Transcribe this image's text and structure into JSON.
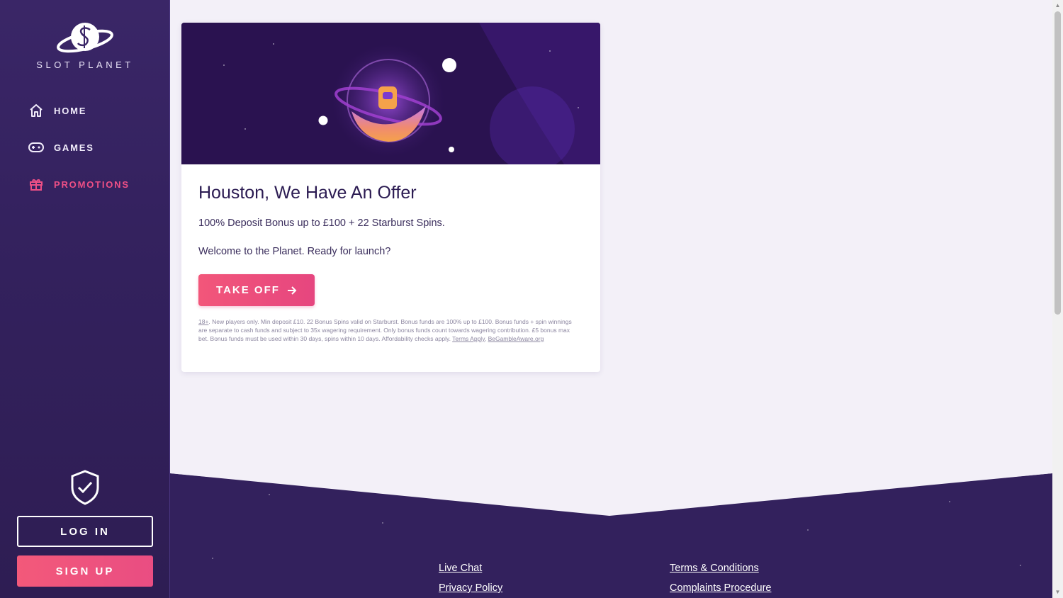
{
  "brand": {
    "name": "SLOT PLANET"
  },
  "nav": [
    {
      "label": "HOME",
      "icon": "home-icon",
      "active": false
    },
    {
      "label": "GAMES",
      "icon": "gamepad-icon",
      "active": false
    },
    {
      "label": "PROMOTIONS",
      "icon": "gift-icon",
      "active": true
    }
  ],
  "auth": {
    "login_label": "LOG IN",
    "signup_label": "SIGN UP"
  },
  "promo": {
    "title": "Houston, We Have An Offer",
    "line1": "100% Deposit Bonus up to £100 + 22 Starburst Spins.",
    "line2": "Welcome to the Planet. Ready for launch?",
    "cta_label": "TAKE OFF",
    "terms_age": "18+",
    "terms_text": ". New players only. Min deposit £10. 22 Bonus Spins valid on Starburst. Bonus funds are 100% up to £100. Bonus funds + spin winnings are separate to cash funds and subject to 35x wagering requirement. Only bonus funds count towards wagering contribution. £5 bonus max bet. Bonus funds must be used within 30 days, spins within 10 days. Affordability checks apply. ",
    "terms_apply": "Terms Apply",
    "terms_gamble": "BeGambleAware.org"
  },
  "footer": {
    "links": [
      "Live Chat",
      "Privacy Policy",
      "Terms & Conditions",
      "Complaints Procedure"
    ]
  },
  "colors": {
    "accent": "#ef4f86",
    "sidebar": "#33215d",
    "background": "#f3f0f8"
  }
}
